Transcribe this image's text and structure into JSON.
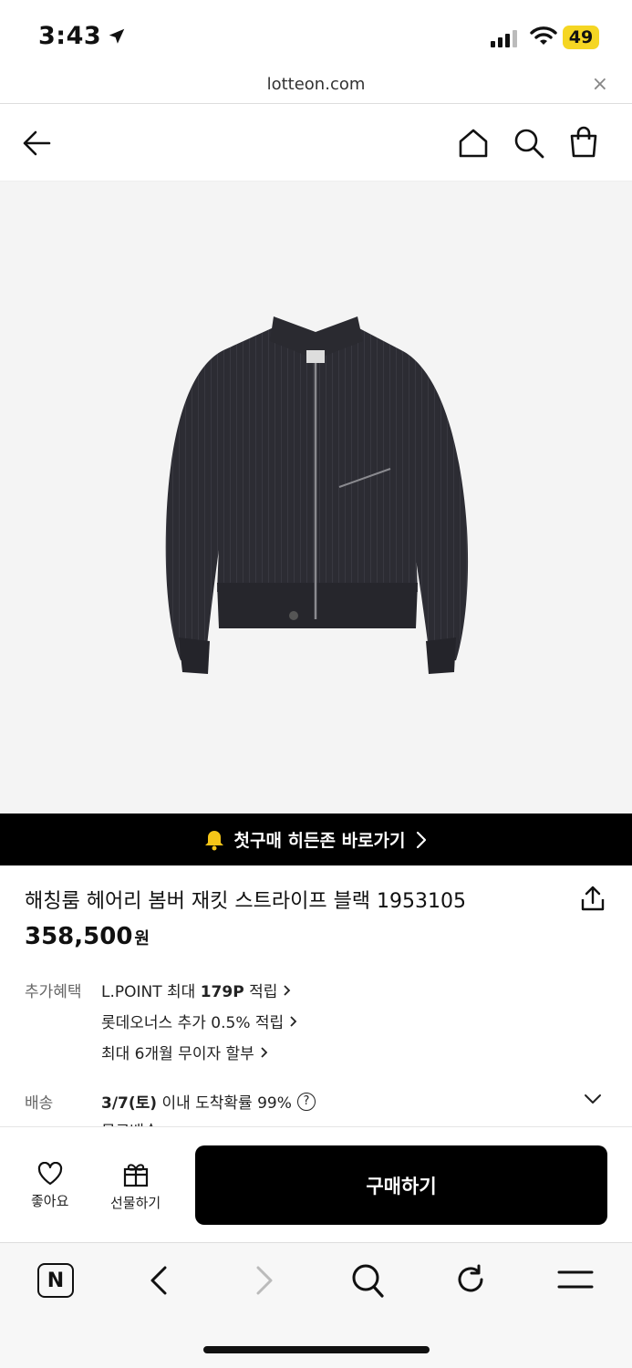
{
  "status_bar": {
    "time": "3:43",
    "battery": "49"
  },
  "browser": {
    "url": "lotteon.com",
    "close_label": "×"
  },
  "banner": {
    "text": "첫구매 히든존 바로가기"
  },
  "product": {
    "title": "해칭룸 헤어리 봄버 재킷 스트라이프 블랙 1953105",
    "price": "358,500",
    "currency": "원"
  },
  "benefits": {
    "label": "추가혜택",
    "items": [
      {
        "prefix": "L.POINT 최대 ",
        "bold": "179P",
        "suffix": " 적립"
      },
      {
        "prefix": "롯데오너스 추가 0.5% 적립",
        "bold": "",
        "suffix": ""
      },
      {
        "prefix": "최대 6개월 무이자 할부",
        "bold": "",
        "suffix": ""
      }
    ]
  },
  "delivery": {
    "label": "배송",
    "date": "3/7(토)",
    "text": " 이내 도착확률 99%",
    "help": "?",
    "partial": "무료배송"
  },
  "actions": {
    "like": "좋아요",
    "gift": "선물하기",
    "buy": "구매하기"
  },
  "browser_bar": {
    "n_logo": "N"
  },
  "colors": {
    "banner_bg": "#000000",
    "buy_bg": "#000000",
    "battery": "#f5d623",
    "image_bg": "#f4f4f4"
  }
}
